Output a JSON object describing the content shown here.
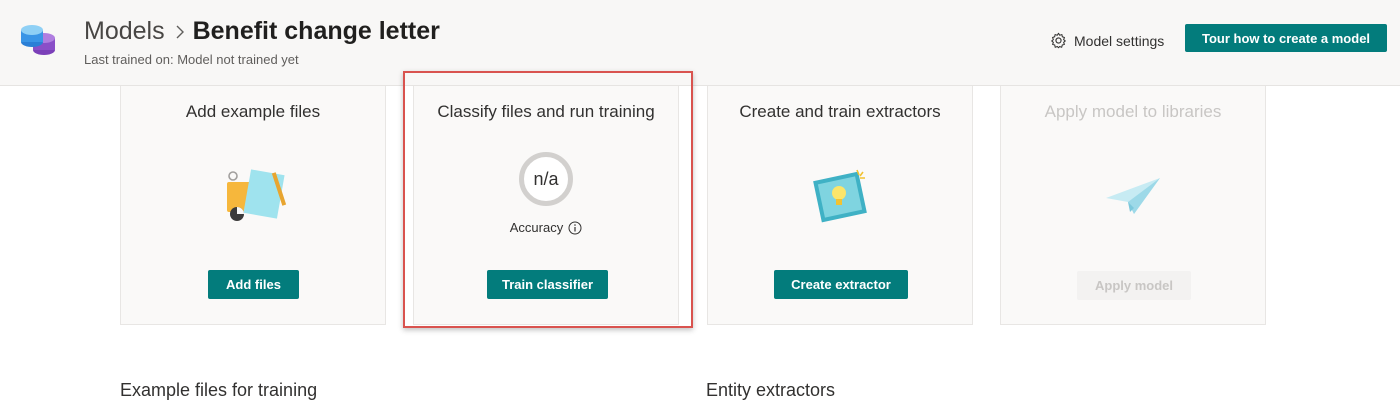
{
  "header": {
    "breadcrumb_root": "Models",
    "title": "Benefit change letter",
    "subtitle": "Last trained on: Model not trained yet",
    "model_settings_label": "Model settings",
    "tour_button_label": "Tour how to create a model"
  },
  "cards": [
    {
      "title": "Add example files",
      "button_label": "Add files"
    },
    {
      "title": "Classify files and run training",
      "accuracy_value": "n/a",
      "accuracy_label": "Accuracy",
      "button_label": "Train classifier"
    },
    {
      "title": "Create and train extractors",
      "button_label": "Create extractor"
    },
    {
      "title": "Apply model to libraries",
      "button_label": "Apply model"
    }
  ],
  "sections": {
    "example_files": "Example files for training",
    "entity_extractors": "Entity extractors"
  },
  "colors": {
    "primary": "#037c7c",
    "highlight": "#d9534f",
    "disabled_text": "#c8c6c4"
  },
  "icons": [
    "syntex-logo-icon",
    "chevron-right-icon",
    "gear-icon",
    "info-icon",
    "files-illustration",
    "extractor-illustration",
    "paper-plane-illustration"
  ]
}
